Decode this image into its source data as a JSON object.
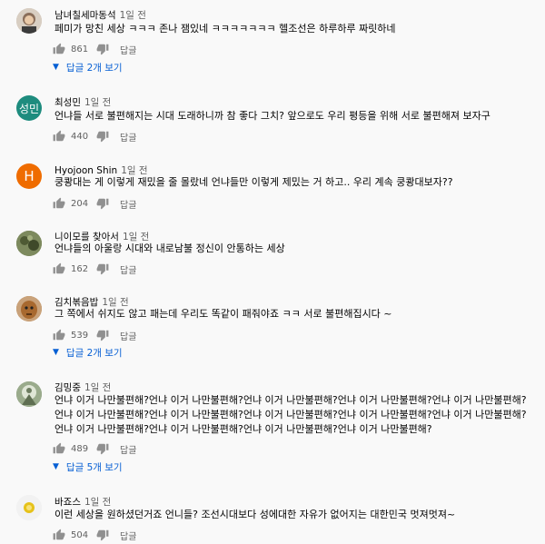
{
  "comments": [
    {
      "author": "남녀칠세마동석",
      "time": "1일 전",
      "text": "페미가 망친 세상 ㅋㅋㅋ 존나 잼있네 ㅋㅋㅋㅋㅋㅋㅋ 헬조선은 하루하루 짜릿하네",
      "likes": "861",
      "reply_label": "답글",
      "replies_label": "답글 2개 보기",
      "avatar": {
        "type": "photo",
        "bg": "#c9c0b6"
      }
    },
    {
      "author": "최성민",
      "time": "1일 전",
      "text": "언냐들 서로 불편해지는 시대 도래하니까 참 좋다 그치? 앞으로도 우리 평등을 위해 서로 불편해져 보자구",
      "likes": "440",
      "reply_label": "답글",
      "avatar": {
        "type": "letter",
        "letter": "성민",
        "bg": "#1e8c7e"
      }
    },
    {
      "author": "Hyojoon Shin",
      "time": "1일 전",
      "text": "쿵쾅대는 게 이렇게 재밌을 줄 몰랐네 언냐들만 이렇게 제밌는 거 하고.. 우리 계속 쿵쾅대보자??",
      "likes": "204",
      "reply_label": "답글",
      "avatar": {
        "type": "letter",
        "letter": "H",
        "bg": "#ef6c00"
      }
    },
    {
      "author": "니이모를 찾아서",
      "time": "1일 전",
      "text": "언냐들의 아울랑 시대와 내로남불 정신이 안통하는 세상",
      "likes": "162",
      "reply_label": "답글",
      "avatar": {
        "type": "photo",
        "bg": "#6f7a52"
      }
    },
    {
      "author": "김치볶음밥",
      "time": "1일 전",
      "text": "그 쪽에서 쉬지도 않고 패는데 우리도 똑같이 패줘야죠 ㅋㅋ 서로 불편해집시다 ~",
      "likes": "539",
      "reply_label": "답글",
      "replies_label": "답글 2개 보기",
      "avatar": {
        "type": "photo",
        "bg": "#b07a45"
      }
    },
    {
      "author": "김밍중",
      "time": "1일 전",
      "text": "언냐 이거 나만불편해?언냐 이거 나만불편해?언냐 이거 나만불편해?언냐 이거 나만불편해?언냐 이거 나만불편해?언냐 이거 나만불편해?언냐 이거 나만불편해?언냐 이거 나만불편해?언냐 이거 나만불편해?언냐 이거 나만불편해?언냐 이거 나만불편해?언냐 이거 나만불편해?언냐 이거 나만불편해?언냐 이거 나만불편해?",
      "likes": "489",
      "reply_label": "답글",
      "replies_label": "답글 5개 보기",
      "avatar": {
        "type": "photo",
        "bg": "#8a9a7c"
      }
    },
    {
      "author": "바죠스",
      "time": "1일 전",
      "text": "이런 세상을 원하셨던거죠 언니들? 조선시대보다 성에대한 자유가 없어지는 대한민국 멋져멋져~",
      "likes": "504",
      "reply_label": "답글",
      "avatar": {
        "type": "photo",
        "bg": "#eeeeee"
      }
    }
  ],
  "icons": {
    "like": "thumb-up-icon",
    "dislike": "thumb-down-icon",
    "expand": "triangle-down-icon"
  },
  "colors": {
    "link": "#065fd4",
    "meta": "#606060",
    "background": "#f9f9f9"
  }
}
